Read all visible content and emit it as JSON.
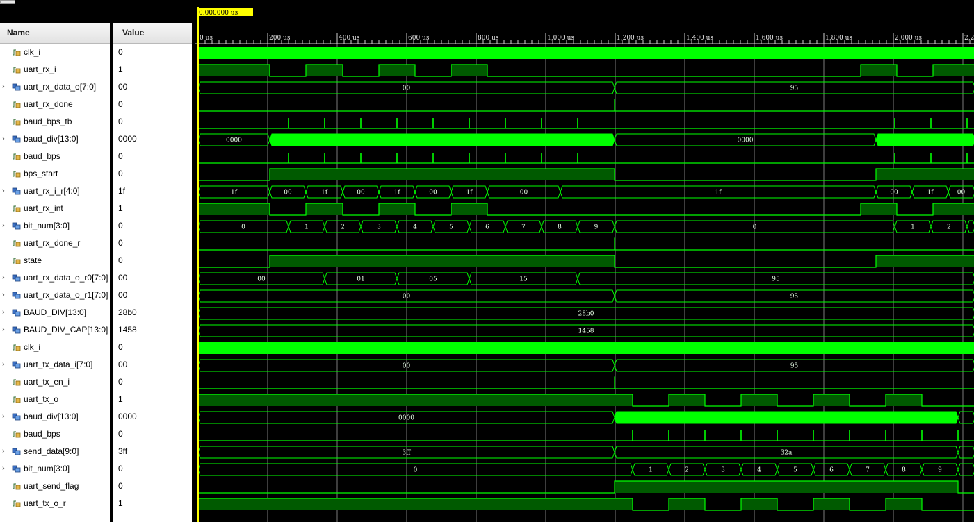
{
  "header": {
    "name_label": "Name",
    "value_label": "Value"
  },
  "cursor": {
    "label": "0.000000 us",
    "time_us": 0
  },
  "ruler": {
    "ticks": [
      {
        "label": "0 us",
        "t": 0
      },
      {
        "label": "200 us",
        "t": 200
      },
      {
        "label": "400 us",
        "t": 400
      },
      {
        "label": "600 us",
        "t": 600
      },
      {
        "label": "800 us",
        "t": 800
      },
      {
        "label": "1,000 us",
        "t": 1000
      },
      {
        "label": "1,200 us",
        "t": 1200
      },
      {
        "label": "1,400 us",
        "t": 1400
      },
      {
        "label": "1,600 us",
        "t": 1600
      },
      {
        "label": "1,800 us",
        "t": 1800
      },
      {
        "label": "2,000 us",
        "t": 2000
      },
      {
        "label": "2,2",
        "t": 2200
      }
    ]
  },
  "colors": {
    "wave": "#00ff00",
    "high_fill": "#005a00",
    "grid": "#9a9a9a",
    "cursor": "#ffff00"
  },
  "signals": [
    {
      "name": "clk_i",
      "value": "0",
      "kind": "bit",
      "expand": false,
      "wave": {
        "type": "clock",
        "segments": [
          [
            0,
            2235
          ]
        ]
      }
    },
    {
      "name": "uart_rx_i",
      "value": "1",
      "kind": "bit",
      "expand": false,
      "wave": {
        "type": "bit",
        "init": 1,
        "edges": [
          206,
          310,
          416,
          520,
          624,
          728,
          832,
          1906,
          2010,
          2114
        ]
      }
    },
    {
      "name": "uart_rx_data_o[7:0]",
      "value": "00",
      "kind": "bus",
      "expand": true,
      "wave": {
        "type": "bus",
        "segs": [
          {
            "s": 0,
            "e": 1198,
            "v": "00"
          },
          {
            "s": 1198,
            "e": 2235,
            "v": "95"
          }
        ]
      }
    },
    {
      "name": "uart_rx_done",
      "value": "0",
      "kind": "bit",
      "expand": false,
      "wave": {
        "type": "bit",
        "init": 0,
        "edges": [
          1198,
          1199
        ]
      }
    },
    {
      "name": "baud_bps_tb",
      "value": "0",
      "kind": "bit",
      "expand": false,
      "wave": {
        "type": "pulses",
        "times": [
          260,
          364,
          468,
          572,
          676,
          780,
          884,
          988,
          1092,
          2004,
          2108,
          2212
        ]
      }
    },
    {
      "name": "baud_div[13:0]",
      "value": "0000",
      "kind": "bus",
      "expand": true,
      "wave": {
        "type": "bus",
        "segs": [
          {
            "s": 0,
            "e": 206,
            "v": "0000"
          },
          {
            "s": 206,
            "e": 1198,
            "v": "",
            "fill": true
          },
          {
            "s": 1198,
            "e": 1950,
            "v": "0000"
          },
          {
            "s": 1950,
            "e": 2235,
            "v": "",
            "fill": true
          }
        ]
      }
    },
    {
      "name": "baud_bps",
      "value": "0",
      "kind": "bit",
      "expand": false,
      "wave": {
        "type": "pulses",
        "times": [
          260,
          364,
          468,
          572,
          676,
          780,
          884,
          988,
          1092,
          2004,
          2108,
          2212
        ]
      }
    },
    {
      "name": "bps_start",
      "value": "0",
      "kind": "bit",
      "expand": false,
      "wave": {
        "type": "bit",
        "init": 0,
        "edges": [
          206,
          1198,
          1950
        ]
      }
    },
    {
      "name": "uart_rx_i_r[4:0]",
      "value": "1f",
      "kind": "bus",
      "expand": true,
      "wave": {
        "type": "bus",
        "segs": [
          {
            "s": 0,
            "e": 206,
            "v": "1f"
          },
          {
            "s": 206,
            "e": 310,
            "v": "00"
          },
          {
            "s": 310,
            "e": 416,
            "v": "1f"
          },
          {
            "s": 416,
            "e": 520,
            "v": "00"
          },
          {
            "s": 520,
            "e": 624,
            "v": "1f"
          },
          {
            "s": 624,
            "e": 728,
            "v": "00"
          },
          {
            "s": 728,
            "e": 832,
            "v": "1f"
          },
          {
            "s": 832,
            "e": 1042,
            "v": "00"
          },
          {
            "s": 1042,
            "e": 1950,
            "v": "1f"
          },
          {
            "s": 1950,
            "e": 2054,
            "v": "00"
          },
          {
            "s": 2054,
            "e": 2158,
            "v": "1f"
          },
          {
            "s": 2158,
            "e": 2235,
            "v": "00"
          }
        ]
      }
    },
    {
      "name": "uart_rx_int",
      "value": "1",
      "kind": "bit",
      "expand": false,
      "wave": {
        "type": "bit",
        "init": 1,
        "edges": [
          206,
          310,
          416,
          520,
          624,
          728,
          832,
          1906,
          2010,
          2114
        ]
      }
    },
    {
      "name": "bit_num[3:0]",
      "value": "0",
      "kind": "bus",
      "expand": true,
      "wave": {
        "type": "bus",
        "segs": [
          {
            "s": 0,
            "e": 260,
            "v": "0"
          },
          {
            "s": 260,
            "e": 364,
            "v": "1"
          },
          {
            "s": 364,
            "e": 468,
            "v": "2"
          },
          {
            "s": 468,
            "e": 572,
            "v": "3"
          },
          {
            "s": 572,
            "e": 676,
            "v": "4"
          },
          {
            "s": 676,
            "e": 780,
            "v": "5"
          },
          {
            "s": 780,
            "e": 884,
            "v": "6"
          },
          {
            "s": 884,
            "e": 988,
            "v": "7"
          },
          {
            "s": 988,
            "e": 1092,
            "v": "8"
          },
          {
            "s": 1092,
            "e": 1198,
            "v": "9"
          },
          {
            "s": 1198,
            "e": 2004,
            "v": "0"
          },
          {
            "s": 2004,
            "e": 2108,
            "v": "1"
          },
          {
            "s": 2108,
            "e": 2212,
            "v": "2"
          },
          {
            "s": 2212,
            "e": 2235,
            "v": ""
          }
        ]
      }
    },
    {
      "name": "uart_rx_done_r",
      "value": "0",
      "kind": "bit",
      "expand": false,
      "wave": {
        "type": "bit",
        "init": 0,
        "edges": [
          1198,
          1199
        ]
      }
    },
    {
      "name": "state",
      "value": "0",
      "kind": "bit",
      "expand": false,
      "wave": {
        "type": "bit",
        "init": 0,
        "edges": [
          206,
          1198,
          1950
        ]
      }
    },
    {
      "name": "uart_rx_data_o_r0[7:0]",
      "value": "00",
      "kind": "bus",
      "expand": true,
      "wave": {
        "type": "bus",
        "segs": [
          {
            "s": 0,
            "e": 364,
            "v": "00"
          },
          {
            "s": 364,
            "e": 572,
            "v": "01"
          },
          {
            "s": 572,
            "e": 780,
            "v": "05"
          },
          {
            "s": 780,
            "e": 1092,
            "v": "15"
          },
          {
            "s": 1092,
            "e": 2235,
            "v": "95"
          }
        ]
      }
    },
    {
      "name": "uart_rx_data_o_r1[7:0]",
      "value": "00",
      "kind": "bus",
      "expand": true,
      "wave": {
        "type": "bus",
        "segs": [
          {
            "s": 0,
            "e": 1198,
            "v": "00"
          },
          {
            "s": 1198,
            "e": 2235,
            "v": "95"
          }
        ]
      }
    },
    {
      "name": "BAUD_DIV[13:0]",
      "value": "28b0",
      "kind": "bus",
      "expand": true,
      "wave": {
        "type": "bus",
        "segs": [
          {
            "s": 0,
            "e": 2235,
            "v": "28b0"
          }
        ]
      }
    },
    {
      "name": "BAUD_DIV_CAP[13:0]",
      "value": "1458",
      "kind": "bus",
      "expand": true,
      "wave": {
        "type": "bus",
        "segs": [
          {
            "s": 0,
            "e": 2235,
            "v": "1458"
          }
        ]
      }
    },
    {
      "name": "clk_i",
      "value": "0",
      "kind": "bit",
      "expand": false,
      "wave": {
        "type": "clock",
        "segments": [
          [
            0,
            2235
          ]
        ]
      }
    },
    {
      "name": "uart_tx_data_i[7:0]",
      "value": "00",
      "kind": "bus",
      "expand": true,
      "wave": {
        "type": "bus",
        "segs": [
          {
            "s": 0,
            "e": 1198,
            "v": "00"
          },
          {
            "s": 1198,
            "e": 2235,
            "v": "95"
          }
        ]
      }
    },
    {
      "name": "uart_tx_en_i",
      "value": "0",
      "kind": "bit",
      "expand": false,
      "wave": {
        "type": "bit",
        "init": 0,
        "edges": [
          1198,
          1199
        ]
      }
    },
    {
      "name": "uart_tx_o",
      "value": "1",
      "kind": "bit",
      "expand": false,
      "wave": {
        "type": "bit",
        "init": 1,
        "edges": [
          1250,
          1354,
          1458,
          1562,
          1666,
          1770,
          1874,
          1978,
          2082
        ]
      }
    },
    {
      "name": "baud_div[13:0]",
      "value": "0000",
      "kind": "bus",
      "expand": true,
      "wave": {
        "type": "bus",
        "segs": [
          {
            "s": 0,
            "e": 1198,
            "v": "0000"
          },
          {
            "s": 1198,
            "e": 2186,
            "v": "",
            "fill": true
          },
          {
            "s": 2186,
            "e": 2235,
            "v": ""
          }
        ]
      }
    },
    {
      "name": "baud_bps",
      "value": "0",
      "kind": "bit",
      "expand": false,
      "wave": {
        "type": "pulses",
        "times": [
          1250,
          1354,
          1458,
          1562,
          1666,
          1770,
          1874,
          1978,
          2082,
          2186
        ]
      }
    },
    {
      "name": "send_data[9:0]",
      "value": "3ff",
      "kind": "bus",
      "expand": true,
      "wave": {
        "type": "bus",
        "segs": [
          {
            "s": 0,
            "e": 1198,
            "v": "3ff"
          },
          {
            "s": 1198,
            "e": 2186,
            "v": "32a"
          },
          {
            "s": 2186,
            "e": 2235,
            "v": ""
          }
        ]
      }
    },
    {
      "name": "bit_num[3:0]",
      "value": "0",
      "kind": "bus",
      "expand": true,
      "wave": {
        "type": "bus",
        "segs": [
          {
            "s": 0,
            "e": 1250,
            "v": "0"
          },
          {
            "s": 1250,
            "e": 1354,
            "v": "1"
          },
          {
            "s": 1354,
            "e": 1458,
            "v": "2"
          },
          {
            "s": 1458,
            "e": 1562,
            "v": "3"
          },
          {
            "s": 1562,
            "e": 1666,
            "v": "4"
          },
          {
            "s": 1666,
            "e": 1770,
            "v": "5"
          },
          {
            "s": 1770,
            "e": 1874,
            "v": "6"
          },
          {
            "s": 1874,
            "e": 1978,
            "v": "7"
          },
          {
            "s": 1978,
            "e": 2082,
            "v": "8"
          },
          {
            "s": 2082,
            "e": 2186,
            "v": "9"
          },
          {
            "s": 2186,
            "e": 2235,
            "v": ""
          }
        ]
      }
    },
    {
      "name": "uart_send_flag",
      "value": "0",
      "kind": "bit",
      "expand": false,
      "wave": {
        "type": "bit",
        "init": 0,
        "edges": [
          1198,
          2186
        ]
      }
    },
    {
      "name": "uart_tx_o_r",
      "value": "1",
      "kind": "bit",
      "expand": false,
      "wave": {
        "type": "bit",
        "init": 1,
        "edges": [
          1250,
          1354,
          1458,
          1562,
          1666,
          1770,
          1874,
          1978,
          2082
        ]
      }
    }
  ]
}
